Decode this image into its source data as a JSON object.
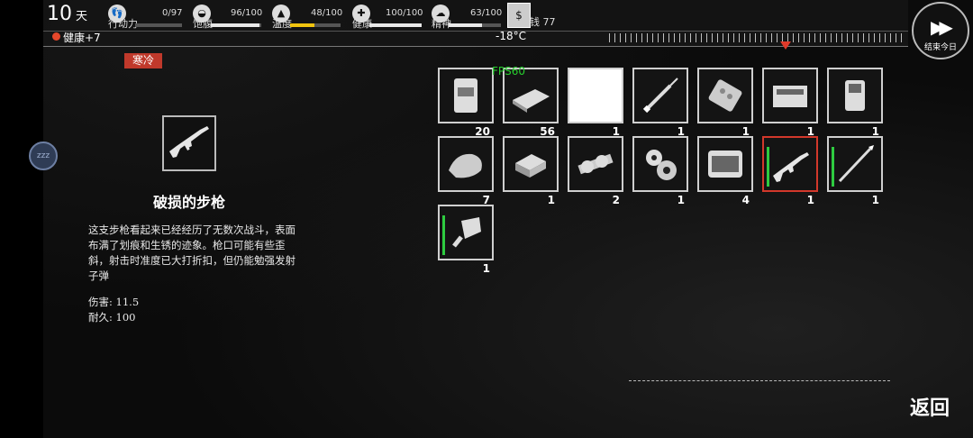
{
  "hud": {
    "day_number": "10",
    "day_unit": "天",
    "stats": [
      {
        "id": "action",
        "label": "行动力",
        "value": "0/97",
        "fill": 0.0,
        "color": "#e8e8e8",
        "icon": "footprints-icon",
        "glyph": "👣"
      },
      {
        "id": "hunger",
        "label": "饱腹",
        "value": "96/100",
        "fill": 0.96,
        "color": "#e8e8e8",
        "icon": "stomach-icon",
        "glyph": "◒"
      },
      {
        "id": "temperature",
        "label": "温度",
        "value": "48/100",
        "fill": 0.48,
        "color": "#f1c40f",
        "icon": "mountain-icon",
        "glyph": "▲"
      },
      {
        "id": "health",
        "label": "健康",
        "value": "100/100",
        "fill": 1.0,
        "color": "#e8e8e8",
        "icon": "medkit-icon",
        "glyph": "✚"
      },
      {
        "id": "spirit",
        "label": "精神",
        "value": "63/100",
        "fill": 0.63,
        "color": "#e8e8e8",
        "icon": "brain-icon",
        "glyph": "☁"
      }
    ],
    "money_label": "钱 77",
    "money_icon_glyph": "$",
    "health_buff": "健康+7",
    "temperature_reading": "-18°C",
    "end_day_label": "结束今日"
  },
  "status_badge": "寒冷",
  "side_button_label": "zzz",
  "detail": {
    "title": "破损的步枪",
    "description": "这支步枪看起来已经经历了无数次战斗，表面布满了划痕和生锈的迹象。枪口可能有些歪斜，射击时准度已大打折扣，但仍能勉强发射子弹",
    "damage": "伤害: 11.5",
    "durability": "耐久: 100"
  },
  "fps_label": "FPS60",
  "inventory": [
    {
      "name": "flour-bag-icon",
      "qty": "20"
    },
    {
      "name": "board-pack-icon",
      "qty": "56"
    },
    {
      "name": "blank-item",
      "qty": "1"
    },
    {
      "name": "syringe-icon",
      "qty": "1"
    },
    {
      "name": "pill-blister-icon",
      "qty": "1"
    },
    {
      "name": "toolbox-icon",
      "qty": "1"
    },
    {
      "name": "radio-icon",
      "qty": "1"
    },
    {
      "name": "meat-icon",
      "qty": "7"
    },
    {
      "name": "tin-box-icon",
      "qty": "1"
    },
    {
      "name": "gear-shaft-icon",
      "qty": "2"
    },
    {
      "name": "gears-icon",
      "qty": "1"
    },
    {
      "name": "tool-kit-icon",
      "qty": "4"
    },
    {
      "name": "rifle-icon",
      "qty": "1"
    },
    {
      "name": "spear-icon",
      "qty": "1"
    },
    {
      "name": "cleaver-icon",
      "qty": "1"
    }
  ],
  "return_label": "返回"
}
